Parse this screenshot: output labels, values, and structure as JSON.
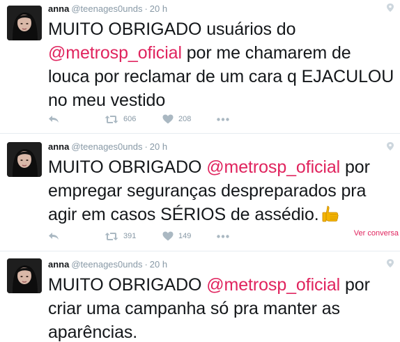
{
  "colors": {
    "mention": "#e0245e",
    "text": "#14171a",
    "muted": "#8899a6",
    "icon": "#aab8c2",
    "divider": "#e6ecf0"
  },
  "tweets": [
    {
      "name": "anna",
      "handle": "@teenages0unds",
      "dot": "·",
      "time": "20 h",
      "text_before": "MUITO OBRIGADO usuários do ",
      "mention": "@metrosp_oficial",
      "text_after": " por me chamarem de louca por reclamar de um cara q EJACULOU no meu vestido",
      "retweets": "606",
      "likes": "208",
      "icons": [
        "avatar",
        "pin-icon",
        "reply-icon",
        "retweet-icon",
        "heart-icon",
        "more-icon"
      ]
    },
    {
      "name": "anna",
      "handle": "@teenages0unds",
      "dot": "·",
      "time": "20 h",
      "text_before": "MUITO OBRIGADO ",
      "mention": "@metrosp_oficial",
      "text_after": " por empregar seguranças despreparados pra agir em casos SÉRIOS de assédio.",
      "emoji": "thumbs-up-icon",
      "retweets": "391",
      "likes": "149",
      "conversation": "Ver conversa"
    },
    {
      "name": "anna",
      "handle": "@teenages0unds",
      "dot": "·",
      "time": "20 h",
      "text_before": "MUITO OBRIGADO ",
      "mention": "@metrosp_oficial",
      "text_after": " por criar uma campanha só pra manter as aparências."
    }
  ]
}
